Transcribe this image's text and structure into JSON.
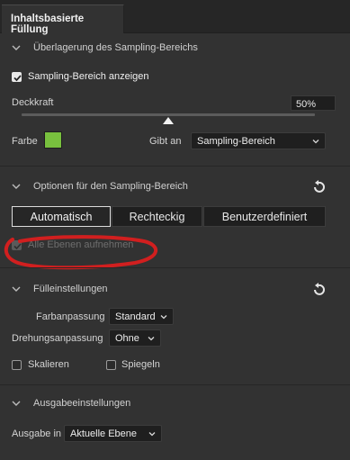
{
  "panel": {
    "tab_label": "Inhaltsbasierte Füllung"
  },
  "overlay_section": {
    "title": "Überlagerung des Sampling-Bereichs",
    "show_sampling_label": "Sampling-Bereich anzeigen",
    "show_sampling_checked": true,
    "opacity_label": "Deckkraft",
    "opacity_value": "50%",
    "opacity_slider_fraction": 0.5,
    "color_label": "Farbe",
    "color_hex": "#78c03e",
    "indicates_label": "Gibt an",
    "indicates_value": "Sampling-Bereich"
  },
  "sampling_options": {
    "title": "Optionen für den Sampling-Bereich",
    "modes": [
      "Automatisch",
      "Rechteckig",
      "Benutzerdefiniert"
    ],
    "active_mode": "Automatisch",
    "all_layers_label": "Alle Ebenen aufnehmen",
    "all_layers_checked": true,
    "all_layers_disabled": true
  },
  "fill_settings": {
    "title": "Fülleinstellungen",
    "color_adapt_label": "Farbanpassung",
    "color_adapt_value": "Standard",
    "rotation_adapt_label": "Drehungsanpassung",
    "rotation_adapt_value": "Ohne",
    "scale_label": "Skalieren",
    "scale_checked": false,
    "mirror_label": "Spiegeln",
    "mirror_checked": false
  },
  "output_settings": {
    "title": "Ausgabeeinstellungen",
    "output_label": "Ausgabe in",
    "output_value": "Aktuelle Ebene"
  },
  "colors": {
    "panel_bg": "#323232",
    "annotation_red": "#d11f1f",
    "swatch_green": "#78c03e"
  },
  "icons": [
    "chevron-down-icon",
    "reset-icon",
    "checkmark-icon",
    "dropdown-caret-icon"
  ]
}
